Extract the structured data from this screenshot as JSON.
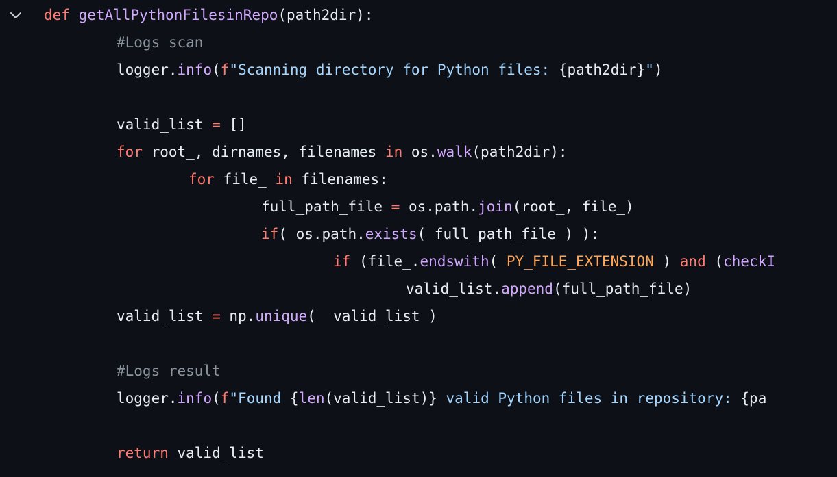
{
  "editor": {
    "fold_icon": "chevron-down-icon",
    "colors": {
      "background": "#0d1117",
      "text": "#e6edf3",
      "keyword": "#ff7b72",
      "function": "#d2a8ff",
      "string": "#a5d6ff",
      "constant": "#ffa657",
      "comment": "#8b949e"
    },
    "lines": [
      {
        "indent": 0,
        "tokens": [
          {
            "t": "kw",
            "s": "def"
          },
          {
            "t": "plain",
            "s": " "
          },
          {
            "t": "fn",
            "s": "getAllPythonFilesinRepo"
          },
          {
            "t": "plain",
            "s": "(path2dir):"
          }
        ]
      },
      {
        "indent": 1,
        "tokens": [
          {
            "t": "cmt",
            "s": "#Logs scan"
          }
        ]
      },
      {
        "indent": 1,
        "tokens": [
          {
            "t": "plain",
            "s": "logger."
          },
          {
            "t": "fn",
            "s": "info"
          },
          {
            "t": "plain",
            "s": "("
          },
          {
            "t": "kw",
            "s": "f"
          },
          {
            "t": "str",
            "s": "\"Scanning directory for Python files: "
          },
          {
            "t": "plain",
            "s": "{path2dir}"
          },
          {
            "t": "str",
            "s": "\""
          },
          {
            "t": "plain",
            "s": ")"
          }
        ]
      },
      {
        "indent": 0,
        "tokens": []
      },
      {
        "indent": 1,
        "tokens": [
          {
            "t": "plain",
            "s": "valid_list "
          },
          {
            "t": "kw",
            "s": "="
          },
          {
            "t": "plain",
            "s": " []"
          }
        ]
      },
      {
        "indent": 1,
        "tokens": [
          {
            "t": "kw",
            "s": "for"
          },
          {
            "t": "plain",
            "s": " root_, dirnames, filenames "
          },
          {
            "t": "kw",
            "s": "in"
          },
          {
            "t": "plain",
            "s": " os."
          },
          {
            "t": "fn",
            "s": "walk"
          },
          {
            "t": "plain",
            "s": "(path2dir):"
          }
        ]
      },
      {
        "indent": 2,
        "tokens": [
          {
            "t": "kw",
            "s": "for"
          },
          {
            "t": "plain",
            "s": " file_ "
          },
          {
            "t": "kw",
            "s": "in"
          },
          {
            "t": "plain",
            "s": " filenames:"
          }
        ]
      },
      {
        "indent": 3,
        "tokens": [
          {
            "t": "plain",
            "s": "full_path_file "
          },
          {
            "t": "kw",
            "s": "="
          },
          {
            "t": "plain",
            "s": " os.path."
          },
          {
            "t": "fn",
            "s": "join"
          },
          {
            "t": "plain",
            "s": "(root_, file_)"
          }
        ]
      },
      {
        "indent": 3,
        "tokens": [
          {
            "t": "kw",
            "s": "if"
          },
          {
            "t": "plain",
            "s": "( os.path."
          },
          {
            "t": "fn",
            "s": "exists"
          },
          {
            "t": "plain",
            "s": "( full_path_file ) ):"
          }
        ]
      },
      {
        "indent": 4,
        "tokens": [
          {
            "t": "kw",
            "s": "if"
          },
          {
            "t": "plain",
            "s": " (file_."
          },
          {
            "t": "fn",
            "s": "endswith"
          },
          {
            "t": "plain",
            "s": "( "
          },
          {
            "t": "const",
            "s": "PY_FILE_EXTENSION"
          },
          {
            "t": "plain",
            "s": " ) "
          },
          {
            "t": "kw",
            "s": "and"
          },
          {
            "t": "plain",
            "s": " ("
          },
          {
            "t": "fn",
            "s": "checkI"
          }
        ]
      },
      {
        "indent": 5,
        "tokens": [
          {
            "t": "plain",
            "s": "valid_list."
          },
          {
            "t": "fn",
            "s": "append"
          },
          {
            "t": "plain",
            "s": "(full_path_file)"
          }
        ]
      },
      {
        "indent": 1,
        "tokens": [
          {
            "t": "plain",
            "s": "valid_list "
          },
          {
            "t": "kw",
            "s": "="
          },
          {
            "t": "plain",
            "s": " np."
          },
          {
            "t": "fn",
            "s": "unique"
          },
          {
            "t": "plain",
            "s": "(  valid_list )"
          }
        ]
      },
      {
        "indent": 0,
        "tokens": []
      },
      {
        "indent": 1,
        "tokens": [
          {
            "t": "cmt",
            "s": "#Logs result"
          }
        ]
      },
      {
        "indent": 1,
        "tokens": [
          {
            "t": "plain",
            "s": "logger."
          },
          {
            "t": "fn",
            "s": "info"
          },
          {
            "t": "plain",
            "s": "("
          },
          {
            "t": "kw",
            "s": "f"
          },
          {
            "t": "str",
            "s": "\"Found "
          },
          {
            "t": "plain",
            "s": "{"
          },
          {
            "t": "fn",
            "s": "len"
          },
          {
            "t": "plain",
            "s": "(valid_list)}"
          },
          {
            "t": "str",
            "s": " valid Python files in repository: "
          },
          {
            "t": "plain",
            "s": "{pa"
          }
        ]
      },
      {
        "indent": 0,
        "tokens": []
      },
      {
        "indent": 1,
        "tokens": [
          {
            "t": "kw",
            "s": "return"
          },
          {
            "t": "plain",
            "s": " valid_list"
          }
        ]
      }
    ]
  }
}
